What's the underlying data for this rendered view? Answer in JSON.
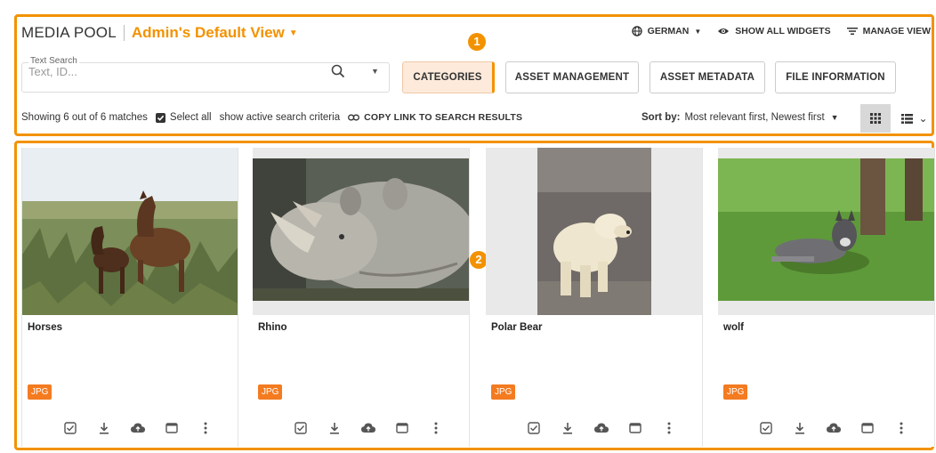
{
  "header": {
    "app_title": "MEDIA POOL",
    "view_name": "Admin's Default View",
    "language_label": "GERMAN",
    "show_widgets_label": "SHOW ALL WIDGETS",
    "manage_view_label": "MANAGE VIEW"
  },
  "search": {
    "legend": "Text Search",
    "placeholder": "Text, ID..."
  },
  "filters": {
    "categories": "CATEGORIES",
    "asset_management": "ASSET MANAGEMENT",
    "asset_metadata": "ASSET METADATA",
    "file_information": "FILE INFORMATION"
  },
  "results": {
    "count_text": "Showing 6 out of 6 matches",
    "select_all": "Select all",
    "active_criteria": "show active search criteria",
    "copy_link": "COPY LINK TO SEARCH RESULTS",
    "sort_label": "Sort by:",
    "sort_value": "Most relevant first, Newest first"
  },
  "callouts": {
    "one": "1",
    "two": "2"
  },
  "cards": [
    {
      "name": "Horses",
      "type": "JPG"
    },
    {
      "name": "Rhino",
      "type": "JPG"
    },
    {
      "name": "Polar Bear",
      "type": "JPG"
    },
    {
      "name": "wolf",
      "type": "JPG"
    }
  ],
  "colors": {
    "accent": "#f39200",
    "badge": "#f47b20",
    "active_filter_bg": "#fdeadb"
  },
  "icons": [
    "globe-icon",
    "eye-icon",
    "filter-icon",
    "search-icon",
    "link-icon",
    "grid-view-icon",
    "list-view-icon",
    "select-checkbox-icon",
    "download-icon",
    "upload-cloud-icon",
    "window-icon",
    "more-vert-icon"
  ]
}
